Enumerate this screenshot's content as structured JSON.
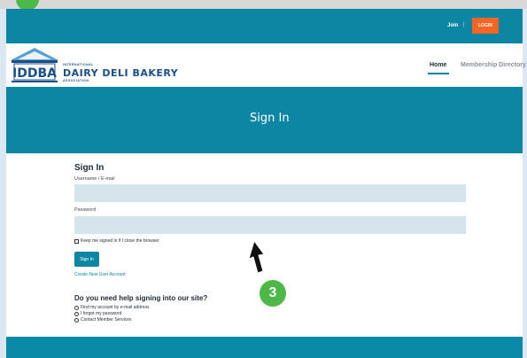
{
  "utility": {
    "join": "Join",
    "separator": "|",
    "login": "LOGIN"
  },
  "brand": {
    "line1": "INTERNATIONAL",
    "name": "DAIRY DELI BAKERY",
    "line3": "ASSOCIATION",
    "logo_text": "IDDBA"
  },
  "nav": {
    "home": "Home",
    "directory": "Membership Directory"
  },
  "hero": {
    "title": "Sign In"
  },
  "form": {
    "title": "Sign In",
    "username_label": "Username / E-mail",
    "username_value": "",
    "password_label": "Password",
    "password_value": "",
    "remember_label": "Keep me signed in if I close the browser",
    "signin_button": "Sign In",
    "create_account": "Create New User Account"
  },
  "help": {
    "title": "Do you need help signing into our site?",
    "options": [
      "Find my account by e-mail address",
      "I forgot my password",
      "Contact Member Services"
    ]
  },
  "overlay": {
    "step": "3"
  },
  "colors": {
    "teal": "#0d86a4",
    "orange": "#f26522",
    "green_badge": "#4db848",
    "field_bg": "#d6e4ec"
  }
}
